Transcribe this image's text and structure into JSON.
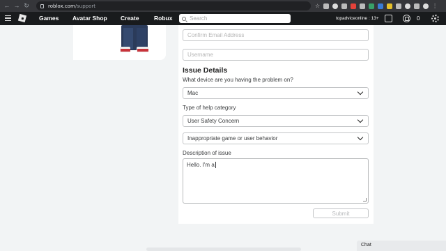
{
  "browser": {
    "url_domain": "roblox.com",
    "url_path": "/support"
  },
  "nav": {
    "links": [
      "Games",
      "Avatar Shop",
      "Create",
      "Robux"
    ],
    "search_placeholder": "Search",
    "username": "topadviceonline : 13+",
    "robux_count": "0"
  },
  "form": {
    "confirm_email_placeholder": "Confirm Email Address",
    "username_placeholder": "Username",
    "issue_details_title": "Issue Details",
    "device_label": "What device are you having the problem on?",
    "device_value": "Mac",
    "help_category_label": "Type of help category",
    "help_category_value": "User Safety Concern",
    "subcategory_value": "Inappropriate game or user behavior",
    "description_label": "Description of issue",
    "description_value": "Hello. I'm a",
    "submit_label": "Submit"
  },
  "chat": {
    "label": "Chat"
  }
}
